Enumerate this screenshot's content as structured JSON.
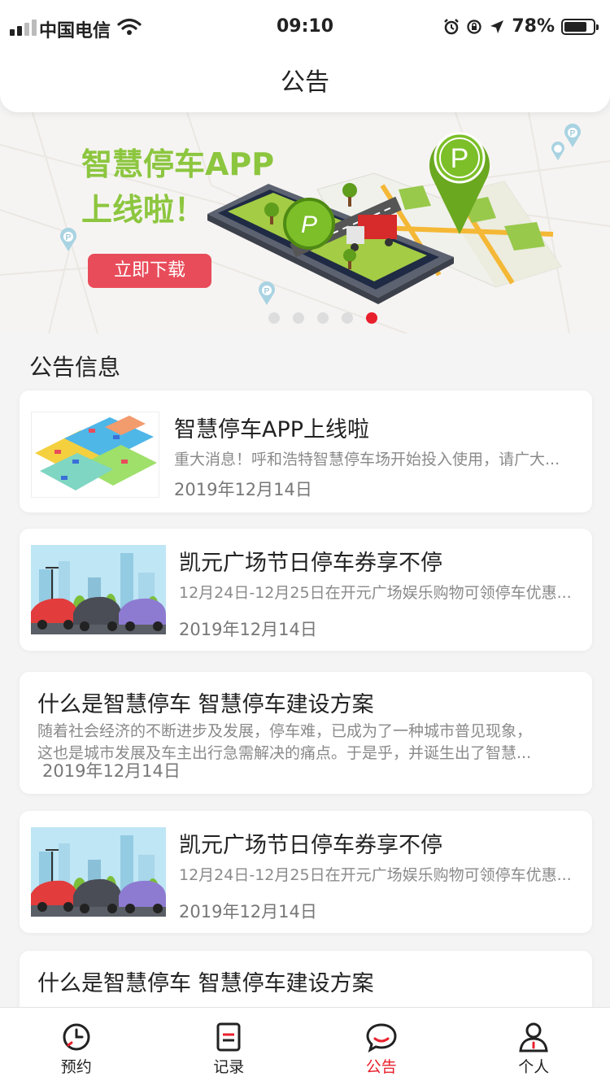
{
  "status_bar": {
    "carrier": "中国电信",
    "time": "09:10",
    "battery": "78%",
    "battery_level": 0.78
  },
  "header": {
    "title": "公告"
  },
  "banner": {
    "headline_line1": "智慧停车APP",
    "headline_line2": "上线啦！",
    "button_label": "立即下载",
    "parking_mark": "P",
    "pages": 5,
    "active_page": 5
  },
  "section": {
    "title": "公告信息"
  },
  "announcements": [
    {
      "title": "智慧停车APP上线啦",
      "desc": "重大消息！呼和浩特智慧停车场开始投入使用，请广大...",
      "date": "2019年12月14日"
    },
    {
      "title": "凯元广场节日停车券享不停",
      "desc": "12月24日-12月25日在开元广场娱乐购物可领停车优惠...",
      "date": "2019年12月14日"
    },
    {
      "title": "什么是智慧停车 智慧停车建设方案",
      "desc_line1": "随着社会经济的不断进步及发展，停车难，已成为了一种城市普见现象，",
      "desc_line2": "这也是城市发展及车主出行急需解决的痛点。于是乎，并诞生出了智慧...",
      "date": "2019年12月14日"
    },
    {
      "title": "凯元广场节日停车券享不停",
      "desc": "12月24日-12月25日在开元广场娱乐购物可领停车优惠...",
      "date": "2019年12月14日"
    },
    {
      "title": "什么是智慧停车 智慧停车建设方案"
    }
  ],
  "tabbar": {
    "items": [
      {
        "label": "预约",
        "icon": "clock-icon"
      },
      {
        "label": "记录",
        "icon": "list-icon"
      },
      {
        "label": "公告",
        "icon": "chat-bubble-icon"
      },
      {
        "label": "个人",
        "icon": "person-icon"
      }
    ],
    "active_index": 2,
    "accent": "#e8202c"
  },
  "colors": {
    "brand_green": "#8cc63f",
    "download_button": "#e84c5a",
    "accent_red": "#e8202c"
  }
}
